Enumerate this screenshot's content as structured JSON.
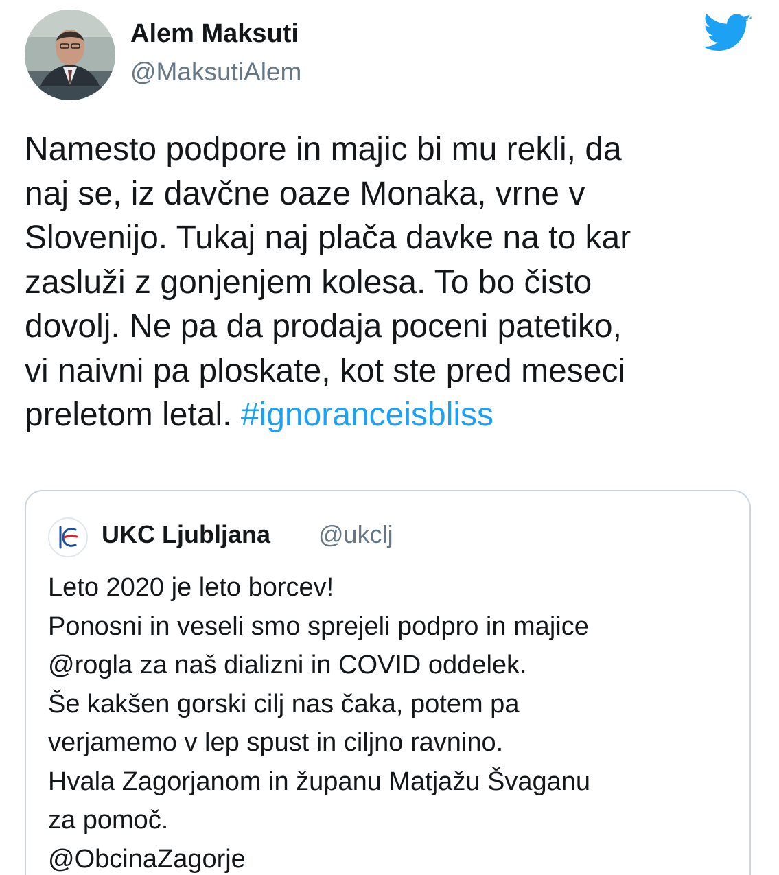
{
  "tweet": {
    "author_name": "Alem Maksuti",
    "author_handle": "@MaksutiAlem",
    "text_lines": [
      "Namesto podpore in majic bi mu rekli, da",
      "naj se, iz davčne oaze Monaka, vrne v",
      "Slovenijo. Tukaj naj plača davke na to kar",
      "zasluži z gonjenjem kolesa. To bo čisto",
      "dovolj. Ne pa da prodaja poceni patetiko,",
      "vi naivni pa ploskate, kot ste pred meseci"
    ],
    "last_line_text": "preletom letal.",
    "hashtag": "#ignoranceisbliss"
  },
  "quoted_tweet": {
    "author_name": "UKC Ljubljana",
    "author_handle": "@ukclj",
    "text_lines": [
      "Leto 2020 je leto borcev!",
      "Ponosni in veseli smo sprejeli podpro in majice",
      "@rogla za naš dializni in COVID oddelek.",
      "Še kakšen gorski cilj nas čaka, potem pa",
      "verjamemo v lep spust in ciljno ravnino.",
      "Hvala Zagorjanom in županu Matjažu Švaganu",
      "za pomoč.",
      "@ObcinaZagorje"
    ]
  },
  "icons": {
    "brand": "twitter-bird-icon",
    "brand_color": "#1da1f2",
    "hashtag_color": "#1da1f2",
    "handle_color": "#657786"
  }
}
